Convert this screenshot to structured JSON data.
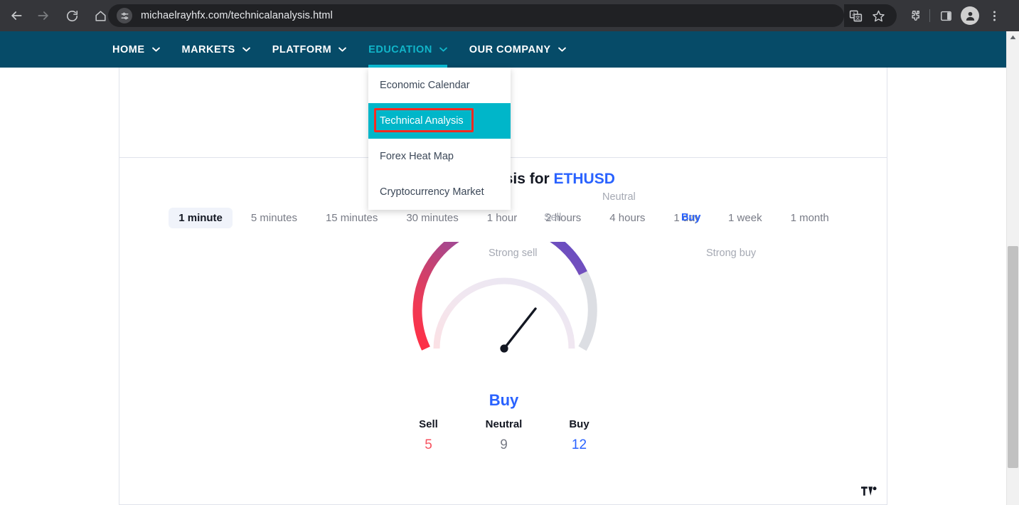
{
  "browser": {
    "url": "michaelrayhfx.com/technicalanalysis.html",
    "back_icon": "back-arrow-icon",
    "forward_icon": "forward-arrow-icon",
    "reload_icon": "reload-icon",
    "home_icon": "home-icon",
    "site_settings_icon": "site-settings-icon",
    "translate_icon": "translate-icon",
    "bookmark_icon": "star-icon",
    "extensions_icon": "puzzle-piece-icon",
    "side_panel_icon": "side-panel-icon",
    "profile_icon": "profile-avatar-icon",
    "menu_icon": "three-dot-menu-icon"
  },
  "site_nav": {
    "items": [
      {
        "label": "HOME",
        "has_caret": true,
        "active": false
      },
      {
        "label": "MARKETS",
        "has_caret": true,
        "active": false
      },
      {
        "label": "PLATFORM",
        "has_caret": true,
        "active": false
      },
      {
        "label": "EDUCATION",
        "has_caret": true,
        "active": true
      },
      {
        "label": "OUR COMPANY",
        "has_caret": true,
        "active": false
      }
    ],
    "accent_color": "#0bbcd4",
    "background_color": "#064b68"
  },
  "dropdown": {
    "open_for": "EDUCATION",
    "items": [
      {
        "label": "Economic Calendar",
        "highlighted": false
      },
      {
        "label": "Technical Analysis",
        "highlighted": true
      },
      {
        "label": "Forex Heat Map",
        "highlighted": false
      },
      {
        "label": "Cryptocurrency Market",
        "highlighted": false
      }
    ],
    "highlight_background": "#00b6c9",
    "annotation_box_color": "#ff2a20"
  },
  "widget": {
    "title_prefix": "Technical Analysis for ",
    "symbol": "ETHUSD",
    "symbol_color": "#2962ff",
    "intervals": [
      {
        "label": "1 minute",
        "selected": true
      },
      {
        "label": "5 minutes",
        "selected": false
      },
      {
        "label": "15 minutes",
        "selected": false
      },
      {
        "label": "30 minutes",
        "selected": false
      },
      {
        "label": "1 hour",
        "selected": false
      },
      {
        "label": "2 hours",
        "selected": false
      },
      {
        "label": "4 hours",
        "selected": false
      },
      {
        "label": "1 day",
        "selected": false
      },
      {
        "label": "1 week",
        "selected": false
      },
      {
        "label": "1 month",
        "selected": false
      }
    ],
    "logo_label": "TradingView",
    "logo_icon": "tradingview-logo-icon"
  },
  "chart_data": {
    "type": "gauge",
    "title": "Technical Analysis for ETHUSD",
    "verdict": "Buy",
    "verdict_color": "#2962ff",
    "zones": [
      {
        "label": "Strong sell",
        "color": "#f7525f"
      },
      {
        "label": "Sell",
        "color": "#b5446e"
      },
      {
        "label": "Neutral",
        "color": "#7e57c2"
      },
      {
        "label": "Buy",
        "color": "#5b4bc4"
      },
      {
        "label": "Strong buy",
        "color": "#dcdee3"
      }
    ],
    "needle_zone": "Buy",
    "needle_angle_deg": 52,
    "counts": {
      "categories": [
        "Sell",
        "Neutral",
        "Buy"
      ],
      "values": [
        5,
        9,
        12
      ],
      "colors": [
        "#f7525f",
        "#787b86",
        "#2962ff"
      ]
    },
    "legend_position": "around-arc",
    "grid": false
  },
  "counters": [
    {
      "label": "Sell",
      "value": "5",
      "kind": "sell"
    },
    {
      "label": "Neutral",
      "value": "9",
      "kind": "neutral"
    },
    {
      "label": "Buy",
      "value": "12",
      "kind": "buy"
    }
  ],
  "gauge_labels": {
    "strong_sell": "Strong sell",
    "sell": "Sell",
    "neutral": "Neutral",
    "buy": "Buy",
    "strong_buy": "Strong buy",
    "verdict": "Buy"
  },
  "scrollbar": {
    "up_arrow_icon": "scroll-up-arrow-icon"
  }
}
